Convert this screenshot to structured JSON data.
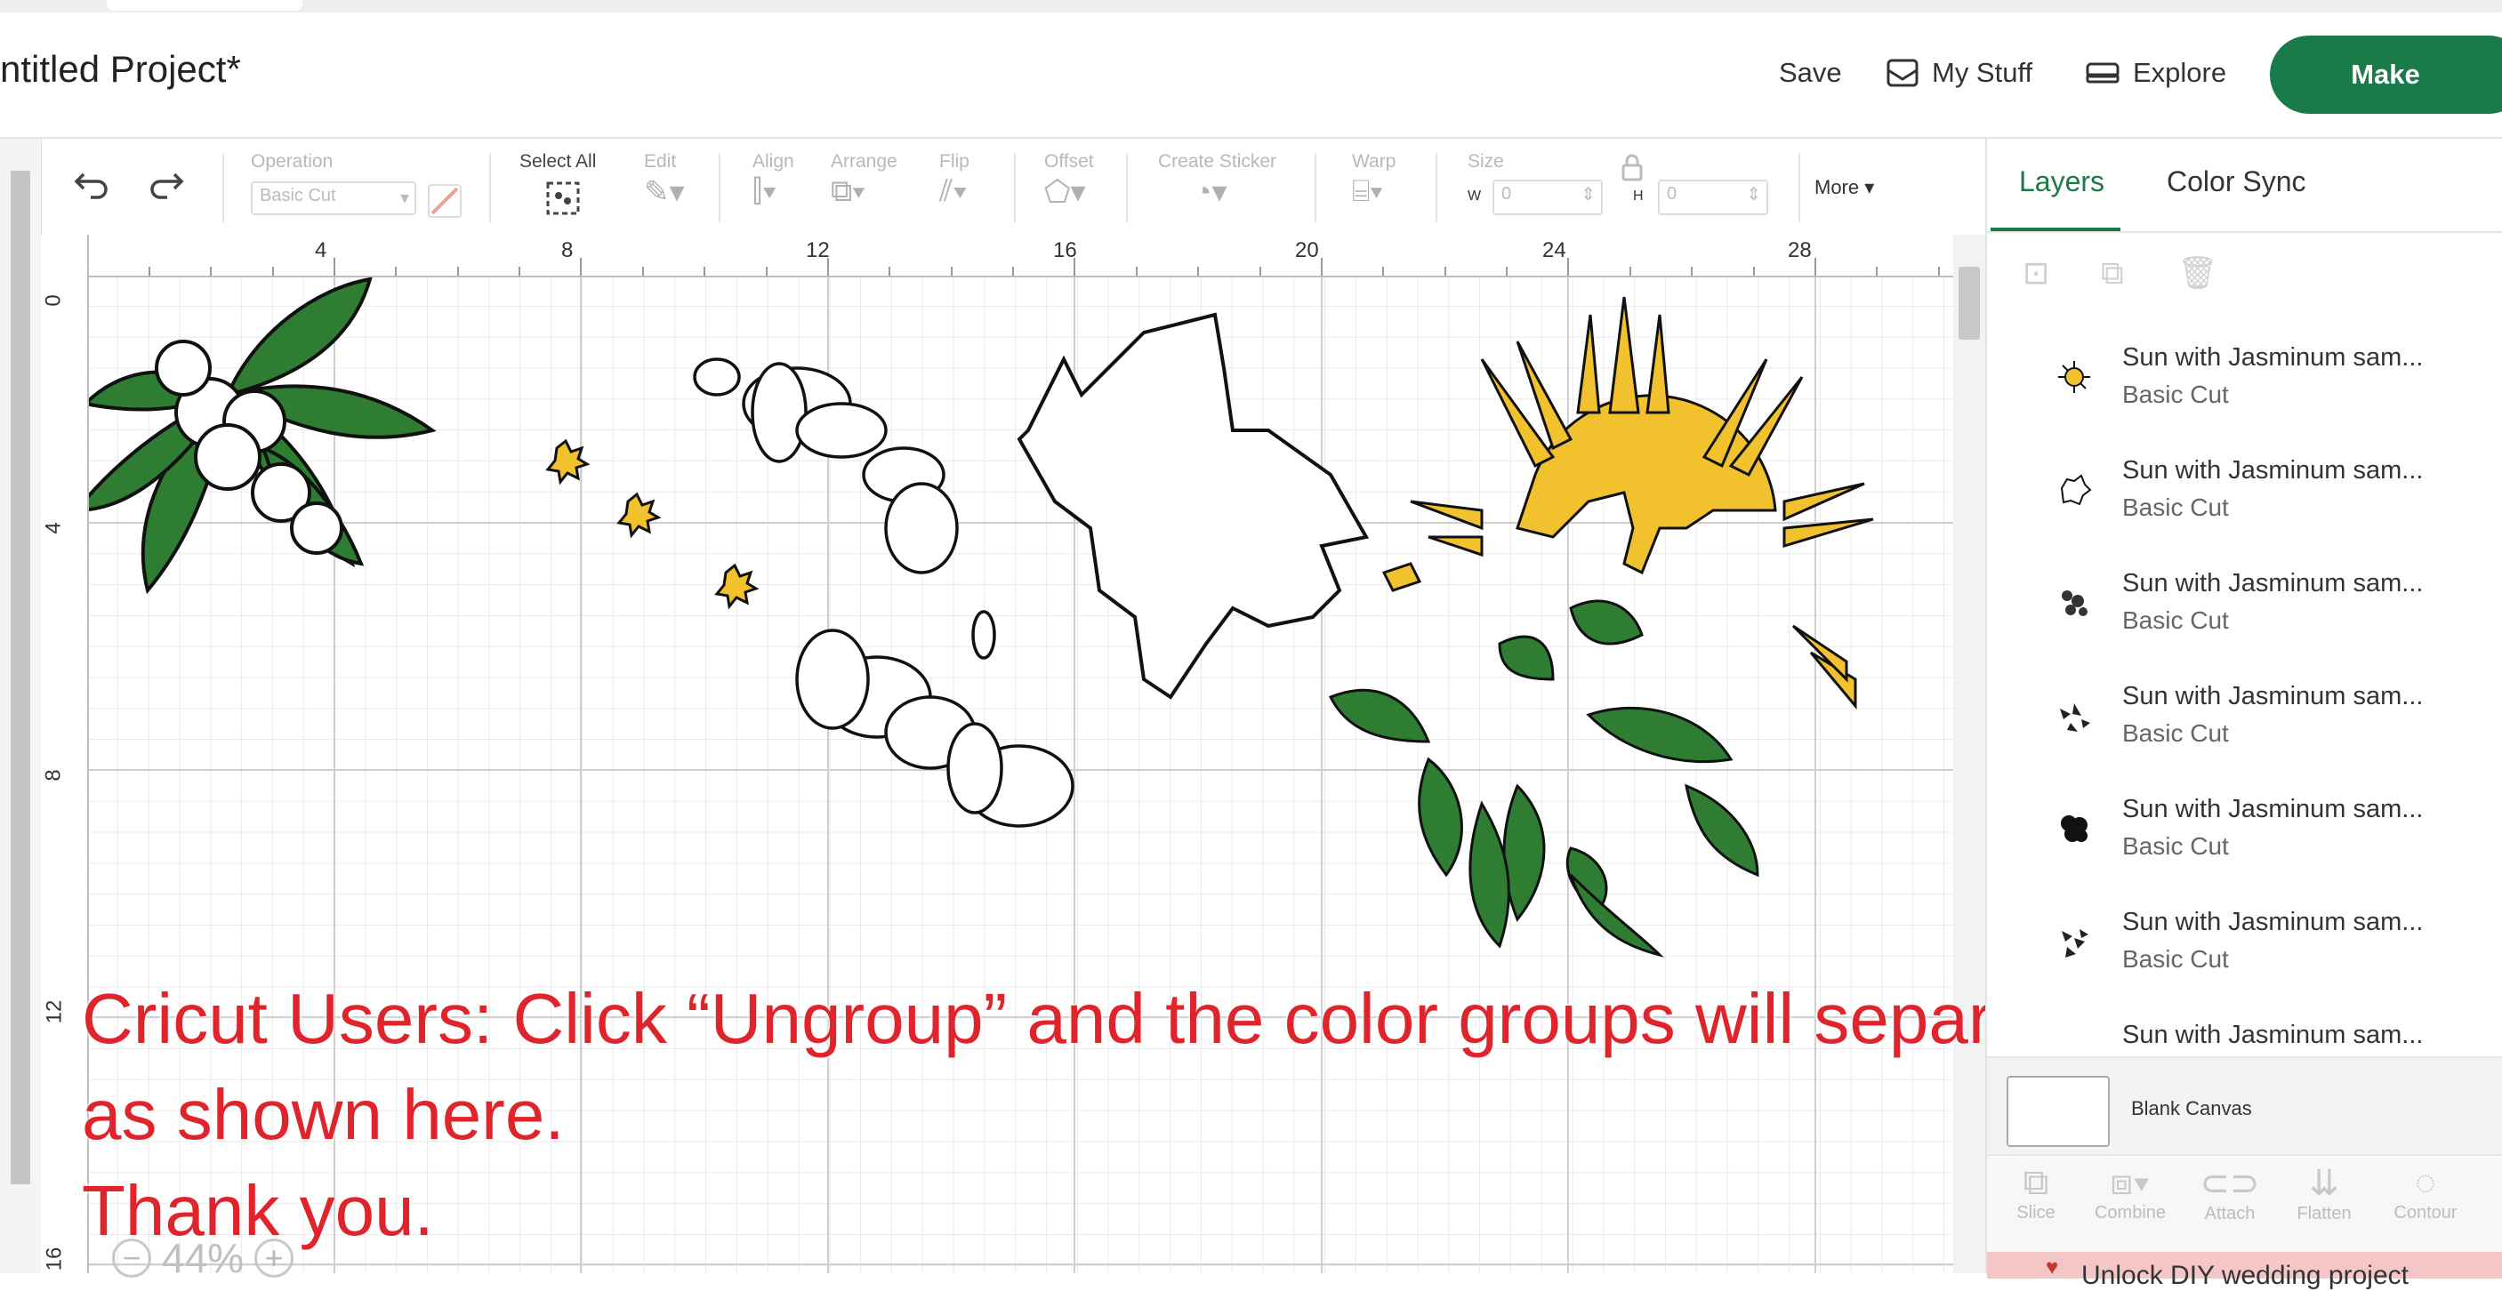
{
  "header": {
    "project_title": "ntitled Project*",
    "save_label": "Save",
    "my_stuff_label": "My Stuff",
    "explore_label": "Explore",
    "make_label": "Make"
  },
  "toolbar": {
    "operation_label": "Operation",
    "operation_value": "Basic Cut",
    "select_all_label": "Select All",
    "edit_label": "Edit",
    "align_label": "Align",
    "arrange_label": "Arrange",
    "flip_label": "Flip",
    "offset_label": "Offset",
    "create_sticker_label": "Create Sticker",
    "warp_label": "Warp",
    "size_label": "Size",
    "width_label": "W",
    "width_value": "0",
    "height_label": "H",
    "height_value": "0",
    "more_label": "More"
  },
  "ruler": {
    "top": [
      "4",
      "8",
      "12",
      "16",
      "20",
      "24",
      "28"
    ],
    "left": [
      "0",
      "4",
      "8",
      "12",
      "16"
    ]
  },
  "canvas": {
    "message_line1": "Cricut Users: Click “Ungroup” and the color groups will separate",
    "message_line2": "as shown here.",
    "message_line3": "Thank you.",
    "zoom_value": "44%"
  },
  "right_panel": {
    "tabs": [
      "Layers",
      "Color Sync"
    ],
    "layers": [
      {
        "name": "Sun with Jasminum sam...",
        "op": "Basic Cut"
      },
      {
        "name": "Sun with Jasminum sam...",
        "op": "Basic Cut"
      },
      {
        "name": "Sun with Jasminum sam...",
        "op": "Basic Cut"
      },
      {
        "name": "Sun with Jasminum sam...",
        "op": "Basic Cut"
      },
      {
        "name": "Sun with Jasminum sam...",
        "op": "Basic Cut"
      },
      {
        "name": "Sun with Jasminum sam...",
        "op": "Basic Cut"
      },
      {
        "name": "Sun with Jasminum sam...",
        "op": ""
      }
    ],
    "blank_canvas_label": "Blank Canvas",
    "bottom_tools": [
      "Slice",
      "Combine",
      "Attach",
      "Flatten",
      "Contour"
    ],
    "upsell_text": "Unlock DIY wedding project"
  },
  "colors": {
    "brand_green": "#1b7a4a",
    "message_red": "#e0242c",
    "leaf_green": "#2e7d32",
    "sun_yellow": "#f2c12e"
  }
}
